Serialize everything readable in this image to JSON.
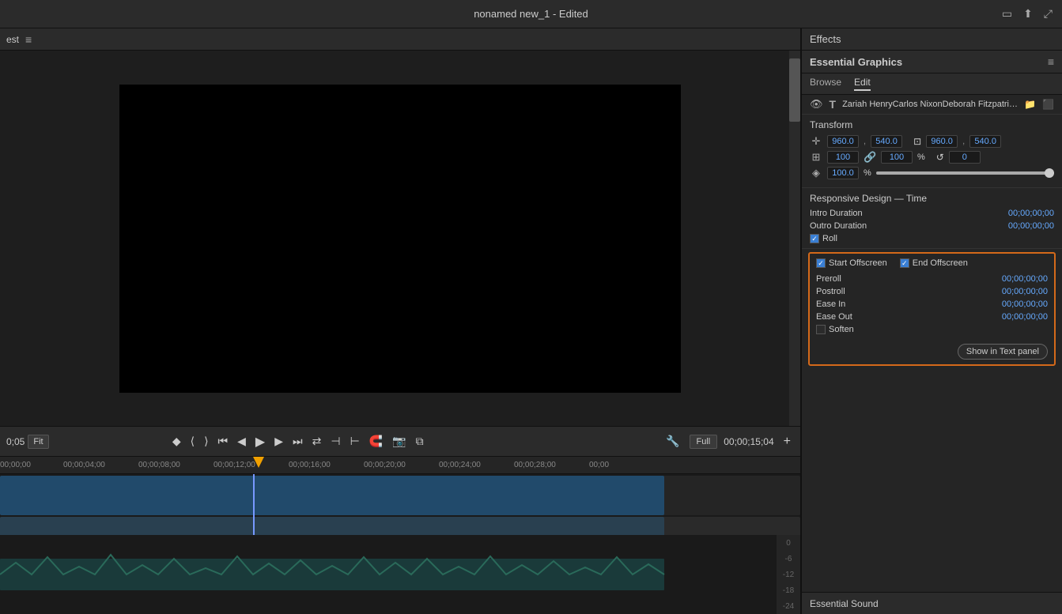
{
  "titleBar": {
    "title": "nonamed new_1",
    "editedLabel": "- Edited",
    "icons": [
      "maximize",
      "export",
      "fullscreen"
    ]
  },
  "leftPanel": {
    "headerText": "est",
    "menuIcon": "≡",
    "preview": {
      "timeCode": "0;05",
      "zoom": "Fit",
      "quality": "Full",
      "wrenchIcon": "🔧",
      "currentTime": "00;00;15;04"
    },
    "controls": {
      "buttons": [
        "marker",
        "in-point",
        "out-point",
        "go-prev-edit",
        "step-back",
        "play",
        "step-forward",
        "go-next-edit",
        "loop",
        "ripple-trim-prev",
        "ripple-trim-next",
        "snap",
        "camera",
        "multi-cam"
      ],
      "playIcon": "▶",
      "addIcon": "+"
    },
    "timeline": {
      "rulerMarks": [
        "00;00;00",
        "00;00;04;00",
        "00;00;08;00",
        "00;00;12;00",
        "00;00;16;00",
        "00;00;20;00",
        "00;00;24;00",
        "00;00;28;00",
        "00;00"
      ],
      "playheadPosition": "00;00;15;04"
    },
    "waveform": {
      "labels": [
        "0",
        "-6",
        "-12",
        "-18",
        "-24"
      ]
    }
  },
  "rightPanel": {
    "effectsLabel": "Effects",
    "essentialGraphics": {
      "title": "Essential Graphics",
      "menuIcon": "≡",
      "tabs": [
        "Browse",
        "Edit"
      ],
      "activeTab": "Edit",
      "layer": {
        "eyeVisible": true,
        "typeIcon": "T",
        "name": "Zariah HenryCarlos NixonDeborah FitzpatrickBlaz...",
        "folderIcon": "📁",
        "alignIcon": "⬛"
      },
      "transform": {
        "label": "Transform",
        "positionIcon": "✛",
        "posX": "960.0",
        "posY": "540.0",
        "scaleIcon": "⊞",
        "scaleLinkedIcon": "🔗",
        "scaleX": "100",
        "scaleY": "100",
        "percentLabel": "%",
        "rotateIcon": "↺",
        "rotateValue": "0",
        "opacityIcon": "◈",
        "opacityValue": "100.0",
        "opacityPercent": "%",
        "anchorIcon": "⊡",
        "anchorX": "960.0",
        "anchorY": "540.0"
      },
      "responsiveDesign": {
        "label": "Responsive Design — Time",
        "introDuration": {
          "label": "Intro Duration",
          "value": "00;00;00;00"
        },
        "outroDuration": {
          "label": "Outro Duration",
          "value": "00;00;00;00"
        },
        "roll": {
          "checkboxChecked": true,
          "label": "Roll"
        }
      },
      "rollOptions": {
        "startOffscreen": {
          "label": "Start Offscreen",
          "checked": true
        },
        "endOffscreen": {
          "label": "End Offscreen",
          "checked": true
        },
        "preroll": {
          "label": "Preroll",
          "value": "00;00;00;00"
        },
        "postroll": {
          "label": "Postroll",
          "value": "00;00;00;00"
        },
        "easeIn": {
          "label": "Ease In",
          "value": "00;00;00;00"
        },
        "easeOut": {
          "label": "Ease Out",
          "value": "00;00;00;00"
        },
        "soften": {
          "label": "Soften",
          "checked": false
        },
        "showInTextPanel": "Show in Text panel"
      }
    },
    "essentialSound": {
      "label": "Essential Sound"
    }
  }
}
